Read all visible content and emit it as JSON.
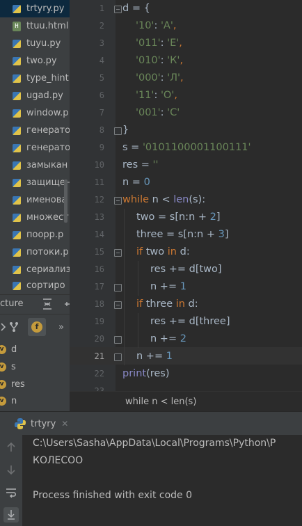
{
  "project_tree": {
    "items": [
      {
        "label": "trtyry.py",
        "type": "py",
        "selected": true
      },
      {
        "label": "ttuu.html",
        "type": "html",
        "selected": false
      },
      {
        "label": "tuyu.py",
        "type": "py",
        "selected": false
      },
      {
        "label": "two.py",
        "type": "py",
        "selected": false
      },
      {
        "label": "type_hint",
        "type": "py",
        "selected": false
      },
      {
        "label": "ugad.py",
        "type": "py",
        "selected": false
      },
      {
        "label": "window.p",
        "type": "py",
        "selected": false
      },
      {
        "label": "генерато",
        "type": "py",
        "selected": false
      },
      {
        "label": "генерато",
        "type": "py",
        "selected": false
      },
      {
        "label": "замыкан",
        "type": "py",
        "selected": false
      },
      {
        "label": "защищен",
        "type": "py",
        "selected": false
      },
      {
        "label": "именова",
        "type": "py",
        "selected": false
      },
      {
        "label": "множест",
        "type": "py",
        "selected": false
      },
      {
        "label": "поорр.р",
        "type": "py",
        "selected": false
      },
      {
        "label": "потоки.р",
        "type": "py",
        "selected": false
      },
      {
        "label": "сериализ",
        "type": "py",
        "selected": false
      },
      {
        "label": "сортиро",
        "type": "py",
        "selected": false
      }
    ]
  },
  "structure": {
    "title": "cture",
    "filter_label": "f",
    "more_label": "»",
    "items": [
      {
        "label": "d",
        "icon": "v"
      },
      {
        "label": "s",
        "icon": "v"
      },
      {
        "label": "res",
        "icon": "v"
      },
      {
        "label": "n",
        "icon": "v"
      }
    ]
  },
  "editor": {
    "current_line": 21,
    "line_numbers": [
      "1",
      "2",
      "3",
      "4",
      "5",
      "6",
      "7",
      "8",
      "9",
      "10",
      "11",
      "12",
      "13",
      "14",
      "15",
      "16",
      "17",
      "18",
      "19",
      "20",
      "21",
      "22",
      "23"
    ],
    "breadcrumb": "while n < len(s)"
  },
  "code_lines": {
    "l1": {
      "a": "d = {"
    },
    "l2": {
      "s": "'10'",
      "c": ": ",
      "v": "'А'",
      "e": ","
    },
    "l3": {
      "s": "'011'",
      "c": ": ",
      "v": "'Е'",
      "e": ","
    },
    "l4": {
      "s": "'010'",
      "c": ": ",
      "v": "'К'",
      "e": ","
    },
    "l5": {
      "s": "'000'",
      "c": ": ",
      "v": "'Л'",
      "e": ","
    },
    "l6": {
      "s": "'11'",
      "c": ": ",
      "v": "'О'",
      "e": ","
    },
    "l7": {
      "s": "'001'",
      "c": ": ",
      "v": "'С'"
    },
    "l8": {
      "a": "}"
    },
    "l9": {
      "a": "s = ",
      "s": "'0101100001100111'"
    },
    "l10": {
      "a": "res = ",
      "s": "''"
    },
    "l11": {
      "a": "n = ",
      "n": "0"
    },
    "l12": {
      "k": "while",
      "a": " n < ",
      "f": "len",
      "b": "(s):"
    },
    "l13": {
      "a": "two = s[n:n + ",
      "n": "2",
      "b": "]"
    },
    "l14": {
      "a": "three = s[n:n + ",
      "n": "3",
      "b": "]"
    },
    "l15": {
      "k": "if",
      "a": " two ",
      "k2": "in",
      "b": " d:"
    },
    "l16": {
      "a": "res += d[two]"
    },
    "l17": {
      "a": "n += ",
      "n": "1"
    },
    "l18": {
      "k": "if",
      "a": " three ",
      "k2": "in",
      "b": " d:"
    },
    "l19": {
      "a": "res += d[three]"
    },
    "l20": {
      "a": "n += ",
      "n": "2"
    },
    "l21": {
      "a": "n += ",
      "n": "1"
    },
    "l22": {
      "f": "print",
      "a": "(res)"
    }
  },
  "run": {
    "tab_label": "trtyry",
    "close_label": "✕",
    "output": [
      "C:\\Users\\Sasha\\AppData\\Local\\Programs\\Python\\P",
      "КОЛЕСОО",
      "",
      "Process finished with exit code 0"
    ]
  },
  "colors": {
    "keyword": "#cc7832",
    "string": "#6a8759",
    "number": "#6897bb",
    "builtin": "#8888c6",
    "text": "#a9b7c6"
  }
}
